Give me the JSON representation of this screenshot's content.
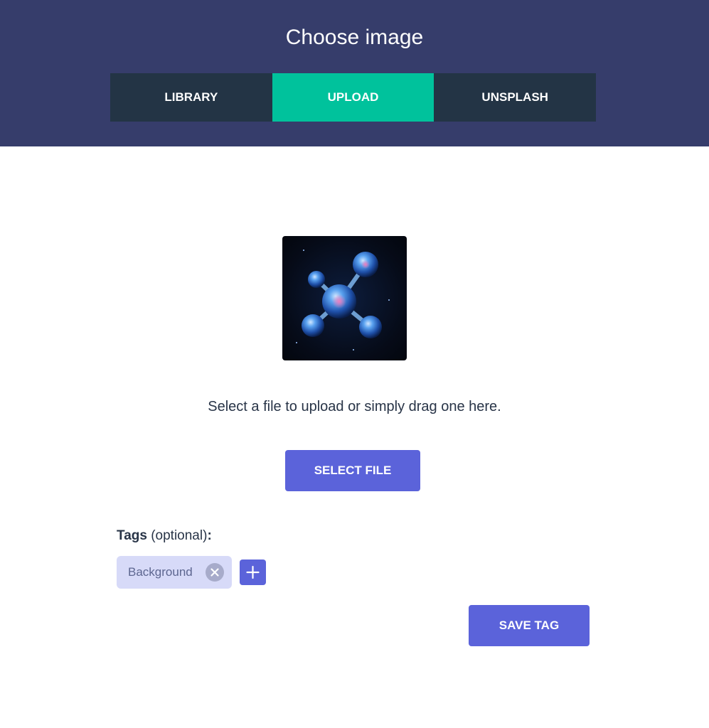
{
  "header": {
    "title": "Choose image",
    "tabs": [
      {
        "label": "LIBRARY"
      },
      {
        "label": "UPLOAD"
      },
      {
        "label": "UNSPLASH"
      }
    ],
    "active_tab": "UPLOAD"
  },
  "upload": {
    "preview_icon": "molecule-image",
    "hint": "Select a file to upload or simply drag one here.",
    "select_button": "SELECT FILE"
  },
  "tags": {
    "label_bold": "Tags",
    "label_rest": " (optional)",
    "label_colon": ":",
    "items": [
      {
        "label": "Background",
        "remove_icon": "close-circle-icon"
      }
    ],
    "add_icon": "plus-icon",
    "save_button": "SAVE TAG"
  },
  "colors": {
    "header_bg": "#363d6b",
    "tab_bg": "#233445",
    "tab_active": "#00c29c",
    "primary": "#5b63da",
    "tag_bg": "#d7daf8"
  }
}
